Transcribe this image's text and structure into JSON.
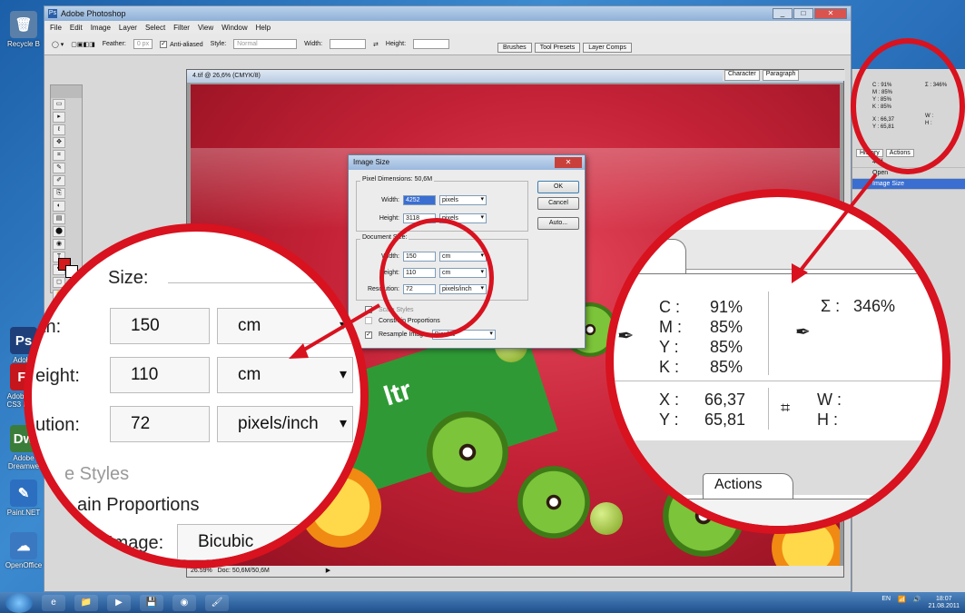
{
  "desktop": {
    "icons": [
      {
        "label": "Recycle B",
        "glyph": "🗑",
        "color": "#5a7fa8"
      },
      {
        "label": "Adobe Photos",
        "glyph": "Ps",
        "color": "#1f3f7a"
      },
      {
        "label": "Adobe Fla CS3 Profe",
        "glyph": "Fl",
        "color": "#c4161c"
      },
      {
        "label": "Adobe Dreamwe",
        "glyph": "Dw",
        "color": "#3a7d3a"
      },
      {
        "label": "Paint.NET",
        "glyph": "✎",
        "color": "#2c6fc0"
      },
      {
        "label": "OpenOffice",
        "glyph": "☁",
        "color": "#3a78c2"
      }
    ]
  },
  "photoshop": {
    "title": "Adobe Photoshop",
    "menu": [
      "File",
      "Edit",
      "Image",
      "Layer",
      "Select",
      "Filter",
      "View",
      "Window",
      "Help"
    ],
    "options": {
      "feather_label": "Feather:",
      "feather_value": "0 px",
      "antialiased": "Anti-aliased",
      "style_label": "Style:",
      "style_value": "Normal",
      "width_label": "Width:",
      "height_label": "Height:"
    },
    "palette_tabs": [
      "Brushes",
      "Tool Presets",
      "Layer Comps"
    ],
    "document": {
      "title": "4.tif @ 26,6% (CMYK/8)",
      "status_zoom": "26.59%",
      "status_doc": "Doc: 50,6M/50,6M",
      "package_text": "ltr"
    },
    "character_tabs": [
      "Character",
      "Paragraph"
    ],
    "history": {
      "tabs": [
        "History",
        "Actions"
      ],
      "items": [
        "4.tif",
        "Open",
        "Image Size"
      ],
      "selected": 2
    }
  },
  "image_size_dialog": {
    "title": "Image Size",
    "pixel_dimensions": "Pixel Dimensions: 50,6M",
    "pixel_width_label": "Width:",
    "pixel_width_value": "4252",
    "pixel_width_unit": "pixels",
    "pixel_height_label": "Height:",
    "pixel_height_value": "3118",
    "pixel_height_unit": "pixels",
    "document_size": "Document Size:",
    "doc_width_label": "Width:",
    "doc_width_value": "150",
    "doc_width_unit": "cm",
    "doc_height_label": "Height:",
    "doc_height_value": "110",
    "doc_height_unit": "cm",
    "resolution_label": "Resolution:",
    "resolution_value": "72",
    "resolution_unit": "pixels/inch",
    "scale_styles": "Scale Styles",
    "constrain": "Constrain Proportions",
    "resample": "Resample Image:",
    "resample_value": "Bicubic",
    "ok": "OK",
    "cancel": "Cancel",
    "auto": "Auto..."
  },
  "zoom_left": {
    "size_heading": "Size:",
    "width_label": "th:",
    "width_value": "150",
    "width_unit": "cm",
    "height_label": "eight:",
    "height_value": "110",
    "height_unit": "cm",
    "resolution_label": "ution:",
    "resolution_value": "72",
    "resolution_unit": "pixels/inch",
    "styles": "e Styles",
    "constrain": "ain Proportions",
    "image_label": "Image:",
    "image_value": "Bicubic"
  },
  "zoom_right": {
    "tab": "o",
    "c_label": "C :",
    "c_value": "91%",
    "m_label": "M :",
    "m_value": "85%",
    "y_label": "Y :",
    "y_value": "85%",
    "k_label": "K :",
    "k_value": "85%",
    "sigma_label": "Σ :",
    "sigma_value": "346%",
    "x_label": "X :",
    "x_value": "66,37",
    "yy_label": "Y :",
    "yy_value": "65,81",
    "w_label": "W :",
    "h_label": "H :",
    "actions_tab": "Actions"
  },
  "small_info": {
    "c": "C :  91%",
    "m": "M :  85%",
    "y": "Y :  85%",
    "k": "K :  85%",
    "sigma": "Σ :  346%",
    "x": "X :  66,37",
    "yy": "Y :  65,81",
    "w": "W :",
    "h": "H :"
  },
  "taskbar": {
    "apps": [
      "e",
      "📁",
      "▶",
      "💾",
      "◉",
      "🖌"
    ],
    "lang": "EN",
    "time": "18:07",
    "date": "21.08.2011"
  },
  "colors": {
    "accent_red": "#d8121f",
    "selection_blue": "#3a6ed0"
  }
}
